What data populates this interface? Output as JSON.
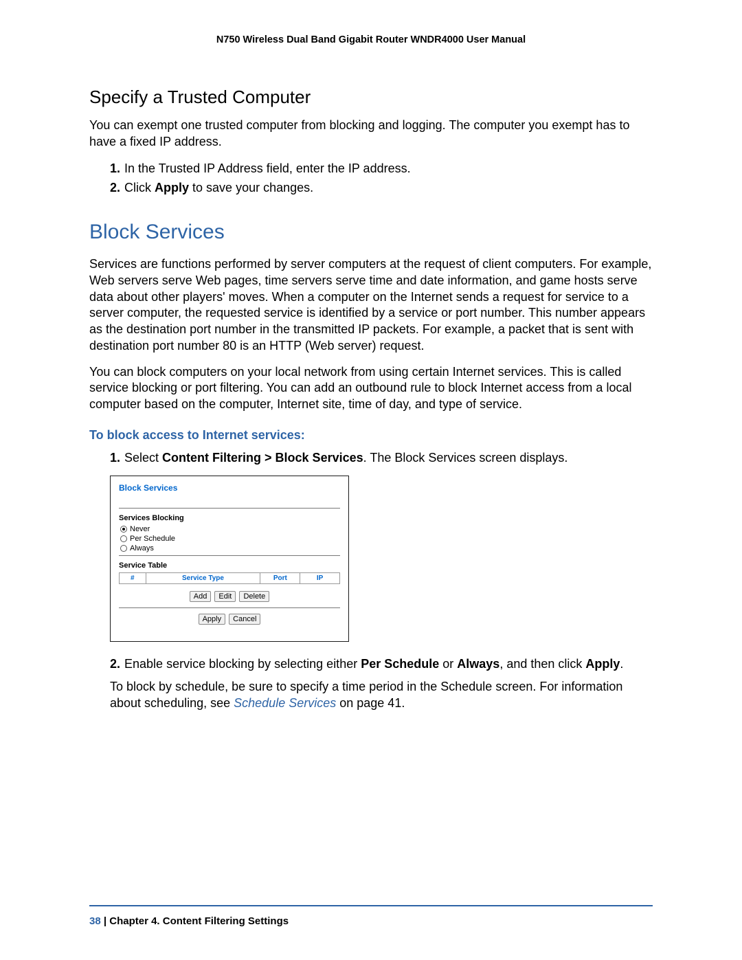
{
  "header": {
    "running_title": "N750 Wireless Dual Band Gigabit Router WNDR4000 User Manual"
  },
  "sec1": {
    "heading": "Specify a Trusted Computer",
    "intro": "You can exempt one trusted computer from blocking and logging. The computer you exempt has to have a fixed IP address.",
    "step1_num": "1.",
    "step1_text": "In the Trusted IP Address field, enter the IP address.",
    "step2_num": "2.",
    "step2_pre": "Click ",
    "step2_bold": "Apply",
    "step2_post": " to save your changes."
  },
  "sec2": {
    "heading": "Block Services",
    "para1": "Services are functions performed by server computers at the request of client computers. For example, Web servers serve Web pages, time servers serve time and date information, and game hosts serve data about other players' moves. When a computer on the Internet sends a request for service to a server computer, the requested service is identified by a service or port number. This number appears as the destination port number in the transmitted IP packets. For example, a packet that is sent with destination port number 80 is an HTTP (Web server) request.",
    "para2": "You can block computers on your local network from using certain Internet services. This is called service blocking or port filtering. You can add an outbound rule to block Internet access from a local computer based on the computer, Internet site, time of day, and type of service.",
    "proc_heading": "To block access to Internet services:",
    "step1_num": "1.",
    "step1_pre": "Select ",
    "step1_bold": "Content Filtering > Block Services",
    "step1_post": ". The Block Services screen displays.",
    "step2_num": "2.",
    "step2_pre": "Enable service blocking by selecting either ",
    "step2_b1": "Per Schedule",
    "step2_mid": " or ",
    "step2_b2": "Always",
    "step2_mid2": ", and then click ",
    "step2_b3": "Apply",
    "step2_end": ".",
    "step2_sub_pre": "To block by schedule, be sure to specify a time period in the Schedule screen. For information about scheduling, see ",
    "step2_sub_link": "Schedule Services",
    "step2_sub_post": " on page 41."
  },
  "shot": {
    "title": "Block Services",
    "sub1": "Services Blocking",
    "r1": "Never",
    "r2": "Per Schedule",
    "r3": "Always",
    "sub2": "Service Table",
    "th1": "#",
    "th2": "Service Type",
    "th3": "Port",
    "th4": "IP",
    "btn_add": "Add",
    "btn_edit": "Edit",
    "btn_delete": "Delete",
    "btn_apply": "Apply",
    "btn_cancel": "Cancel"
  },
  "footer": {
    "page": "38",
    "sep": "   |   ",
    "chapter": "Chapter 4.  Content Filtering Settings"
  }
}
